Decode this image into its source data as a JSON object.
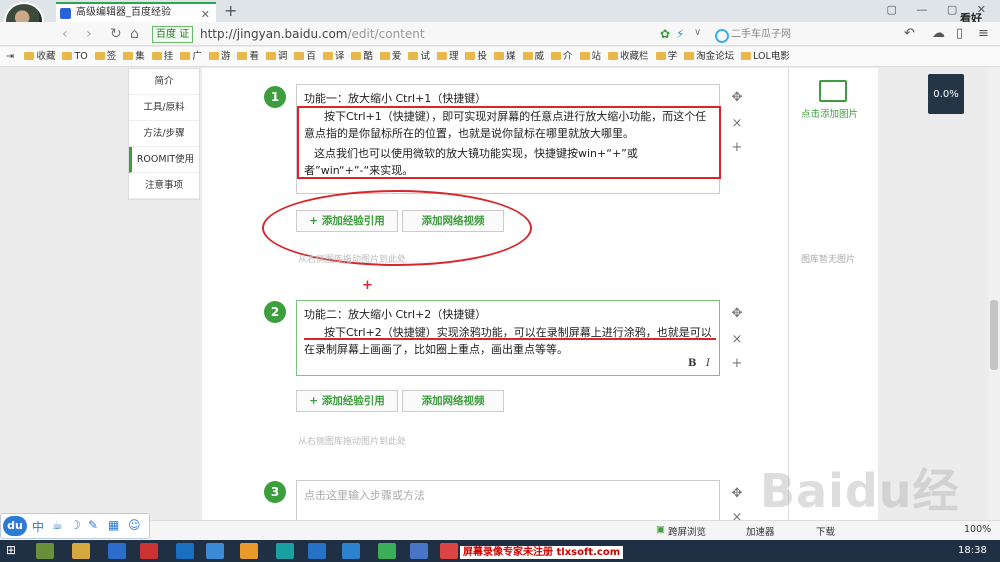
{
  "browser": {
    "tab_title": "高级编辑器_百度经验",
    "url_host": "http://jingyan.baidu.com",
    "url_path": "/edit/content",
    "site_badge": "百度 证",
    "search_placeholder": "二手车瓜子网",
    "viewer_label": "看好",
    "bookmarks": [
      "收藏",
      "TO",
      "签",
      "集",
      "挂",
      "广",
      "游",
      "看",
      "调",
      "百",
      "译",
      "酷",
      "爱",
      "试",
      "理",
      "投",
      "媒",
      "威",
      "介",
      "站",
      "收藏栏",
      "学",
      "淘金论坛",
      "LOL电影"
    ]
  },
  "sidenav": {
    "items": [
      "简介",
      "工具/原料",
      "方法/步骤",
      "ROOMIT使用",
      "注意事项"
    ]
  },
  "steps": [
    {
      "number": "1",
      "title": "功能一：放大缩小 Ctrl+1（快捷键）",
      "para1": "按下Ctrl+1（快捷键），即可实现对屏幕的任意点进行放大缩小功能，而这个任意点指的是你鼠标所在的位置，也就是说你鼠标在哪里就放大哪里。",
      "para2": "这点我们也可以使用微软的放大镜功能实现，快捷键按win+“+”或者”win“+”-“来实现。"
    },
    {
      "number": "2",
      "title": "功能二：放大缩小 Ctrl+2（快捷键）",
      "para1": "按下Ctrl+2（快捷键）实现涂鸦功能，可以在录制屏幕上进行涂鸦，也就是可以在录制屏幕上画画了，比如圈上重点，画出重点等等。"
    },
    {
      "number": "3",
      "placeholder": "点击这里输入步骤或方法"
    }
  ],
  "editor": {
    "add_citation": "+ 添加经验引用",
    "add_video": "添加网络视频",
    "drag_hint": "从右侧图库拖动图片到此处",
    "add_step": "+",
    "bold": "B",
    "italic": "I"
  },
  "rightcol": {
    "add_image": "点击添加图片",
    "empty": "图库暂无图片"
  },
  "progress": {
    "value_percent": 0.0,
    "label": "0.0%"
  },
  "statusbar": {
    "mode": "跨屏浏览",
    "accel": "加速器",
    "download": "下载",
    "zoom": "100%"
  },
  "taskbar": {
    "watermark": "屏幕录像专家未注册 tlxsoft.com",
    "clock": "18:38"
  },
  "page_watermark": "Baidu经验",
  "colors": {
    "accent": "#3c9e3c",
    "annotation": "#d9262b",
    "taskbar": "#1f2f44"
  }
}
